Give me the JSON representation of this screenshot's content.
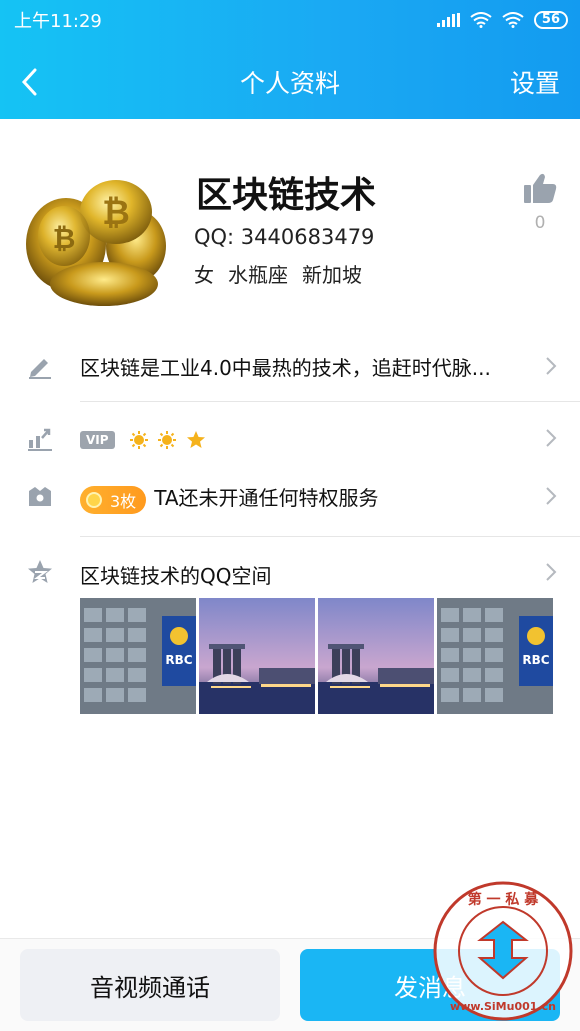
{
  "status_bar": {
    "time": "上午11:29",
    "battery": "56"
  },
  "nav": {
    "title": "个人资料",
    "settings_label": "设置"
  },
  "profile": {
    "name": "区块链技术",
    "qq_label": "QQ: 3440683479",
    "gender": "女",
    "zodiac": "水瓶座",
    "location": "新加坡",
    "like_count": "0"
  },
  "rows": {
    "signature": "区块链是工业4.0中最热的技术，追赶时代脉...",
    "vip_badge": "VIP",
    "coin_count": "3枚",
    "privilege_text": "TA还未开通任何特权服务",
    "qzone_title": "区块链技术的QQ空间"
  },
  "photos": [
    "rbc-building",
    "marina-bay-sands",
    "marina-bay-sands",
    "rbc-building"
  ],
  "bottom": {
    "call_label": "音视频通话",
    "message_label": "发消息"
  },
  "watermark": {
    "top_text": "第 一 私 募",
    "bottom_text": "www.SiMu001.cn"
  },
  "colors": {
    "header_start": "#15c3f4",
    "header_end": "#139bf0",
    "primary_button": "#1ab6f4",
    "coin": "#ffb02e"
  }
}
